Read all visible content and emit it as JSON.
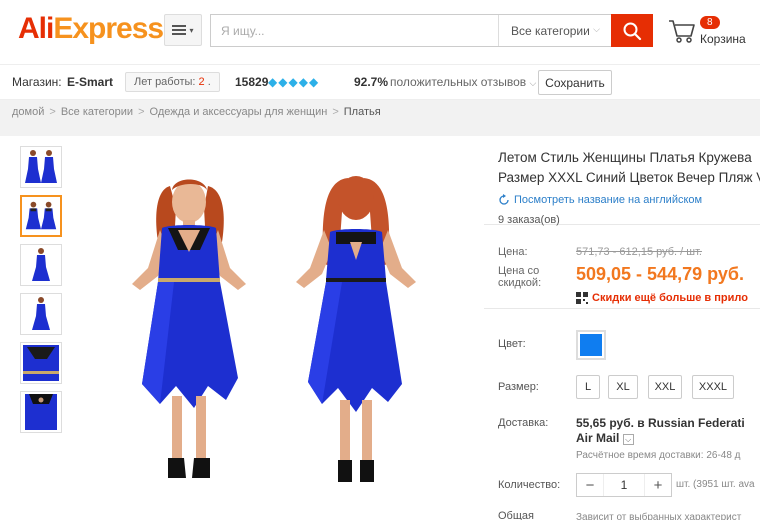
{
  "header": {
    "logo_part1": "Ali",
    "logo_part2": "Express",
    "logo_tm": "™",
    "search_placeholder": "Я ищу...",
    "category_select": "Все категории",
    "cart_count": "8",
    "cart_label": "Корзина"
  },
  "store": {
    "label": "Магазин:",
    "name": "E-Smart",
    "years_label": "Лет работы:",
    "years_value": "2",
    "rating_count": "15829",
    "diamonds": [
      "◆",
      "◆",
      "◆",
      "◆",
      "◆"
    ],
    "positive_percent": "92.7%",
    "positive_label": "положительных отзывов",
    "save_label": "Сохранить"
  },
  "breadcrumb": [
    "домой",
    "Все категории",
    "Одежда и аксессуары для женщин",
    "Платья"
  ],
  "product": {
    "title_line1": "Летом Стиль Женщины Платья Кружева",
    "title_line2": "Размер XXXL Синий Цветок Вечер Пляж V",
    "translate_link": "Посмотреть название на английском",
    "orders": "9 заказа(ов)",
    "price_label": "Цена:",
    "old_price": "571,73 - 612,15 руб. / шт.",
    "discount_label_line1": "Цена со",
    "discount_label_line2": "скидкой:",
    "new_price": "509,05 - 544,79 руб.",
    "promo_text": "Скидки ещё больше в прило",
    "color_label": "Цвет:",
    "color_value": "#0f7df0",
    "size_label": "Размер:",
    "sizes": [
      "L",
      "XL",
      "XXL",
      "XXXL"
    ],
    "shipping_label": "Доставка:",
    "shipping_line1": "55,65 руб. в Russian Federati",
    "shipping_line2": "Air Mail",
    "shipping_time": "Расчётное время доставки: 26-48 д",
    "quantity_label": "Количество:",
    "quantity_value": "1",
    "stock_text": "шт. (3951 шт. ava",
    "total_label": "Общая",
    "total_text": "Зависит от выбранных характерист"
  },
  "colors": {
    "brand_red": "#e62e04",
    "brand_orange": "#f6921e",
    "dress_blue": "#1d2fd0",
    "link_blue": "#2c7fc9"
  }
}
